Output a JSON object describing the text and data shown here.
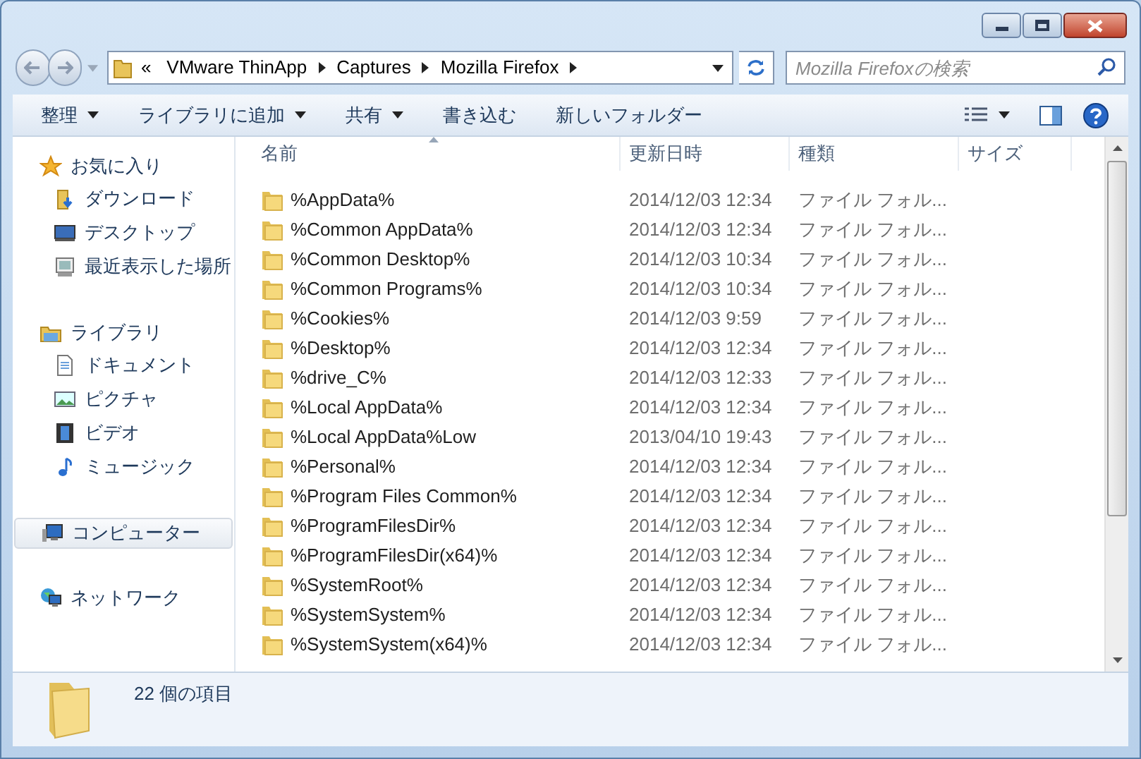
{
  "address_bar": {
    "overflow": "«",
    "breadcrumbs": [
      "VMware ThinApp",
      "Captures",
      "Mozilla Firefox"
    ]
  },
  "search": {
    "placeholder": "Mozilla Firefoxの検索"
  },
  "toolbar": [
    {
      "label": "整理",
      "dropdown": true
    },
    {
      "label": "ライブラリに追加",
      "dropdown": true
    },
    {
      "label": "共有",
      "dropdown": true
    },
    {
      "label": "書き込む",
      "dropdown": false
    },
    {
      "label": "新しいフォルダー",
      "dropdown": false
    }
  ],
  "sidebar": [
    {
      "label": "お気に入り",
      "kind": "star",
      "selected": false,
      "children": [
        {
          "label": "ダウンロード",
          "kind": "download",
          "selected": false
        },
        {
          "label": "デスクトップ",
          "kind": "desktop",
          "selected": false
        },
        {
          "label": "最近表示した場所",
          "kind": "recent",
          "selected": false
        }
      ]
    },
    {
      "label": "ライブラリ",
      "kind": "library",
      "selected": false,
      "children": [
        {
          "label": "ドキュメント",
          "kind": "document",
          "selected": false
        },
        {
          "label": "ピクチャ",
          "kind": "picture",
          "selected": false
        },
        {
          "label": "ビデオ",
          "kind": "video",
          "selected": false
        },
        {
          "label": "ミュージック",
          "kind": "music",
          "selected": false
        }
      ]
    },
    {
      "label": "コンピューター",
      "kind": "computer",
      "selected": true
    },
    {
      "label": "ネットワーク",
      "kind": "network",
      "selected": false
    }
  ],
  "table": {
    "columns": [
      "名前",
      "更新日時",
      "種類",
      "サイズ"
    ],
    "rows": [
      {
        "name": "%AppData%",
        "modified": "2014/12/03 12:34",
        "type": "ファイル フォル..."
      },
      {
        "name": "%Common AppData%",
        "modified": "2014/12/03 12:34",
        "type": "ファイル フォル..."
      },
      {
        "name": "%Common Desktop%",
        "modified": "2014/12/03 10:34",
        "type": "ファイル フォル..."
      },
      {
        "name": "%Common Programs%",
        "modified": "2014/12/03 10:34",
        "type": "ファイル フォル..."
      },
      {
        "name": "%Cookies%",
        "modified": "2014/12/03 9:59",
        "type": "ファイル フォル..."
      },
      {
        "name": "%Desktop%",
        "modified": "2014/12/03 12:34",
        "type": "ファイル フォル..."
      },
      {
        "name": "%drive_C%",
        "modified": "2014/12/03 12:33",
        "type": "ファイル フォル..."
      },
      {
        "name": "%Local AppData%",
        "modified": "2014/12/03 12:34",
        "type": "ファイル フォル..."
      },
      {
        "name": "%Local AppData%Low",
        "modified": "2013/04/10 19:43",
        "type": "ファイル フォル..."
      },
      {
        "name": "%Personal%",
        "modified": "2014/12/03 12:34",
        "type": "ファイル フォル..."
      },
      {
        "name": "%Program Files Common%",
        "modified": "2014/12/03 12:34",
        "type": "ファイル フォル..."
      },
      {
        "name": "%ProgramFilesDir%",
        "modified": "2014/12/03 12:34",
        "type": "ファイル フォル..."
      },
      {
        "name": "%ProgramFilesDir(x64)%",
        "modified": "2014/12/03 12:34",
        "type": "ファイル フォル..."
      },
      {
        "name": "%SystemRoot%",
        "modified": "2014/12/03 12:34",
        "type": "ファイル フォル..."
      },
      {
        "name": "%SystemSystem%",
        "modified": "2014/12/03 12:34",
        "type": "ファイル フォル..."
      },
      {
        "name": "%SystemSystem(x64)%",
        "modified": "2014/12/03 12:34",
        "type": "ファイル フォル..."
      }
    ]
  },
  "details": {
    "summary": "22 個の項目"
  }
}
